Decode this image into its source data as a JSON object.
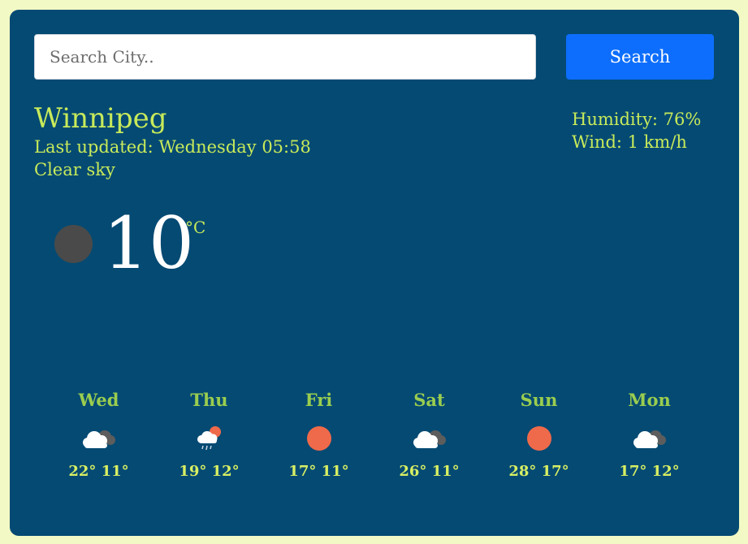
{
  "search": {
    "placeholder": "Search City..",
    "value": "",
    "button_label": "Search"
  },
  "current": {
    "city": "Winnipeg",
    "last_updated": "Last updated: Wednesday 05:58",
    "description": "Clear sky",
    "humidity": "Humidity: 76%",
    "wind": "Wind: 1 km/h",
    "temperature": "10",
    "unit": "°C",
    "icon": "dark-moon-icon"
  },
  "forecast": [
    {
      "day": "Wed",
      "temps": "22° 11°",
      "icon": "cloudy-icon"
    },
    {
      "day": "Thu",
      "temps": "19° 12°",
      "icon": "rain-sun-icon"
    },
    {
      "day": "Fri",
      "temps": "17° 11°",
      "icon": "sun-icon"
    },
    {
      "day": "Sat",
      "temps": "26° 11°",
      "icon": "cloudy-icon"
    },
    {
      "day": "Sun",
      "temps": "28° 17°",
      "icon": "sun-icon"
    },
    {
      "day": "Mon",
      "temps": "17° 12°",
      "icon": "cloudy-icon"
    }
  ],
  "colors": {
    "page_background": "#f2f9c4",
    "card_background": "#044a73",
    "accent_text": "#c8ea5a",
    "button": "#0d6efd",
    "sun": "#ef6a4a"
  }
}
